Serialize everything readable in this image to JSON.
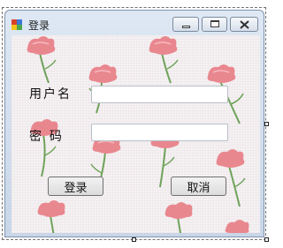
{
  "window": {
    "title": "登录",
    "icon": "app-icon",
    "controls": [
      "minimize-icon",
      "maximize-icon",
      "close-icon"
    ]
  },
  "form": {
    "username_label": "用户名",
    "username_value": "",
    "password_label": "密  码",
    "password_value": ""
  },
  "buttons": {
    "login_label": "登录",
    "cancel_label": "取消"
  },
  "colors": {
    "flower_petal": "#e9878f",
    "flower_stem": "#6fa35a",
    "background": "#f5f2f3"
  }
}
